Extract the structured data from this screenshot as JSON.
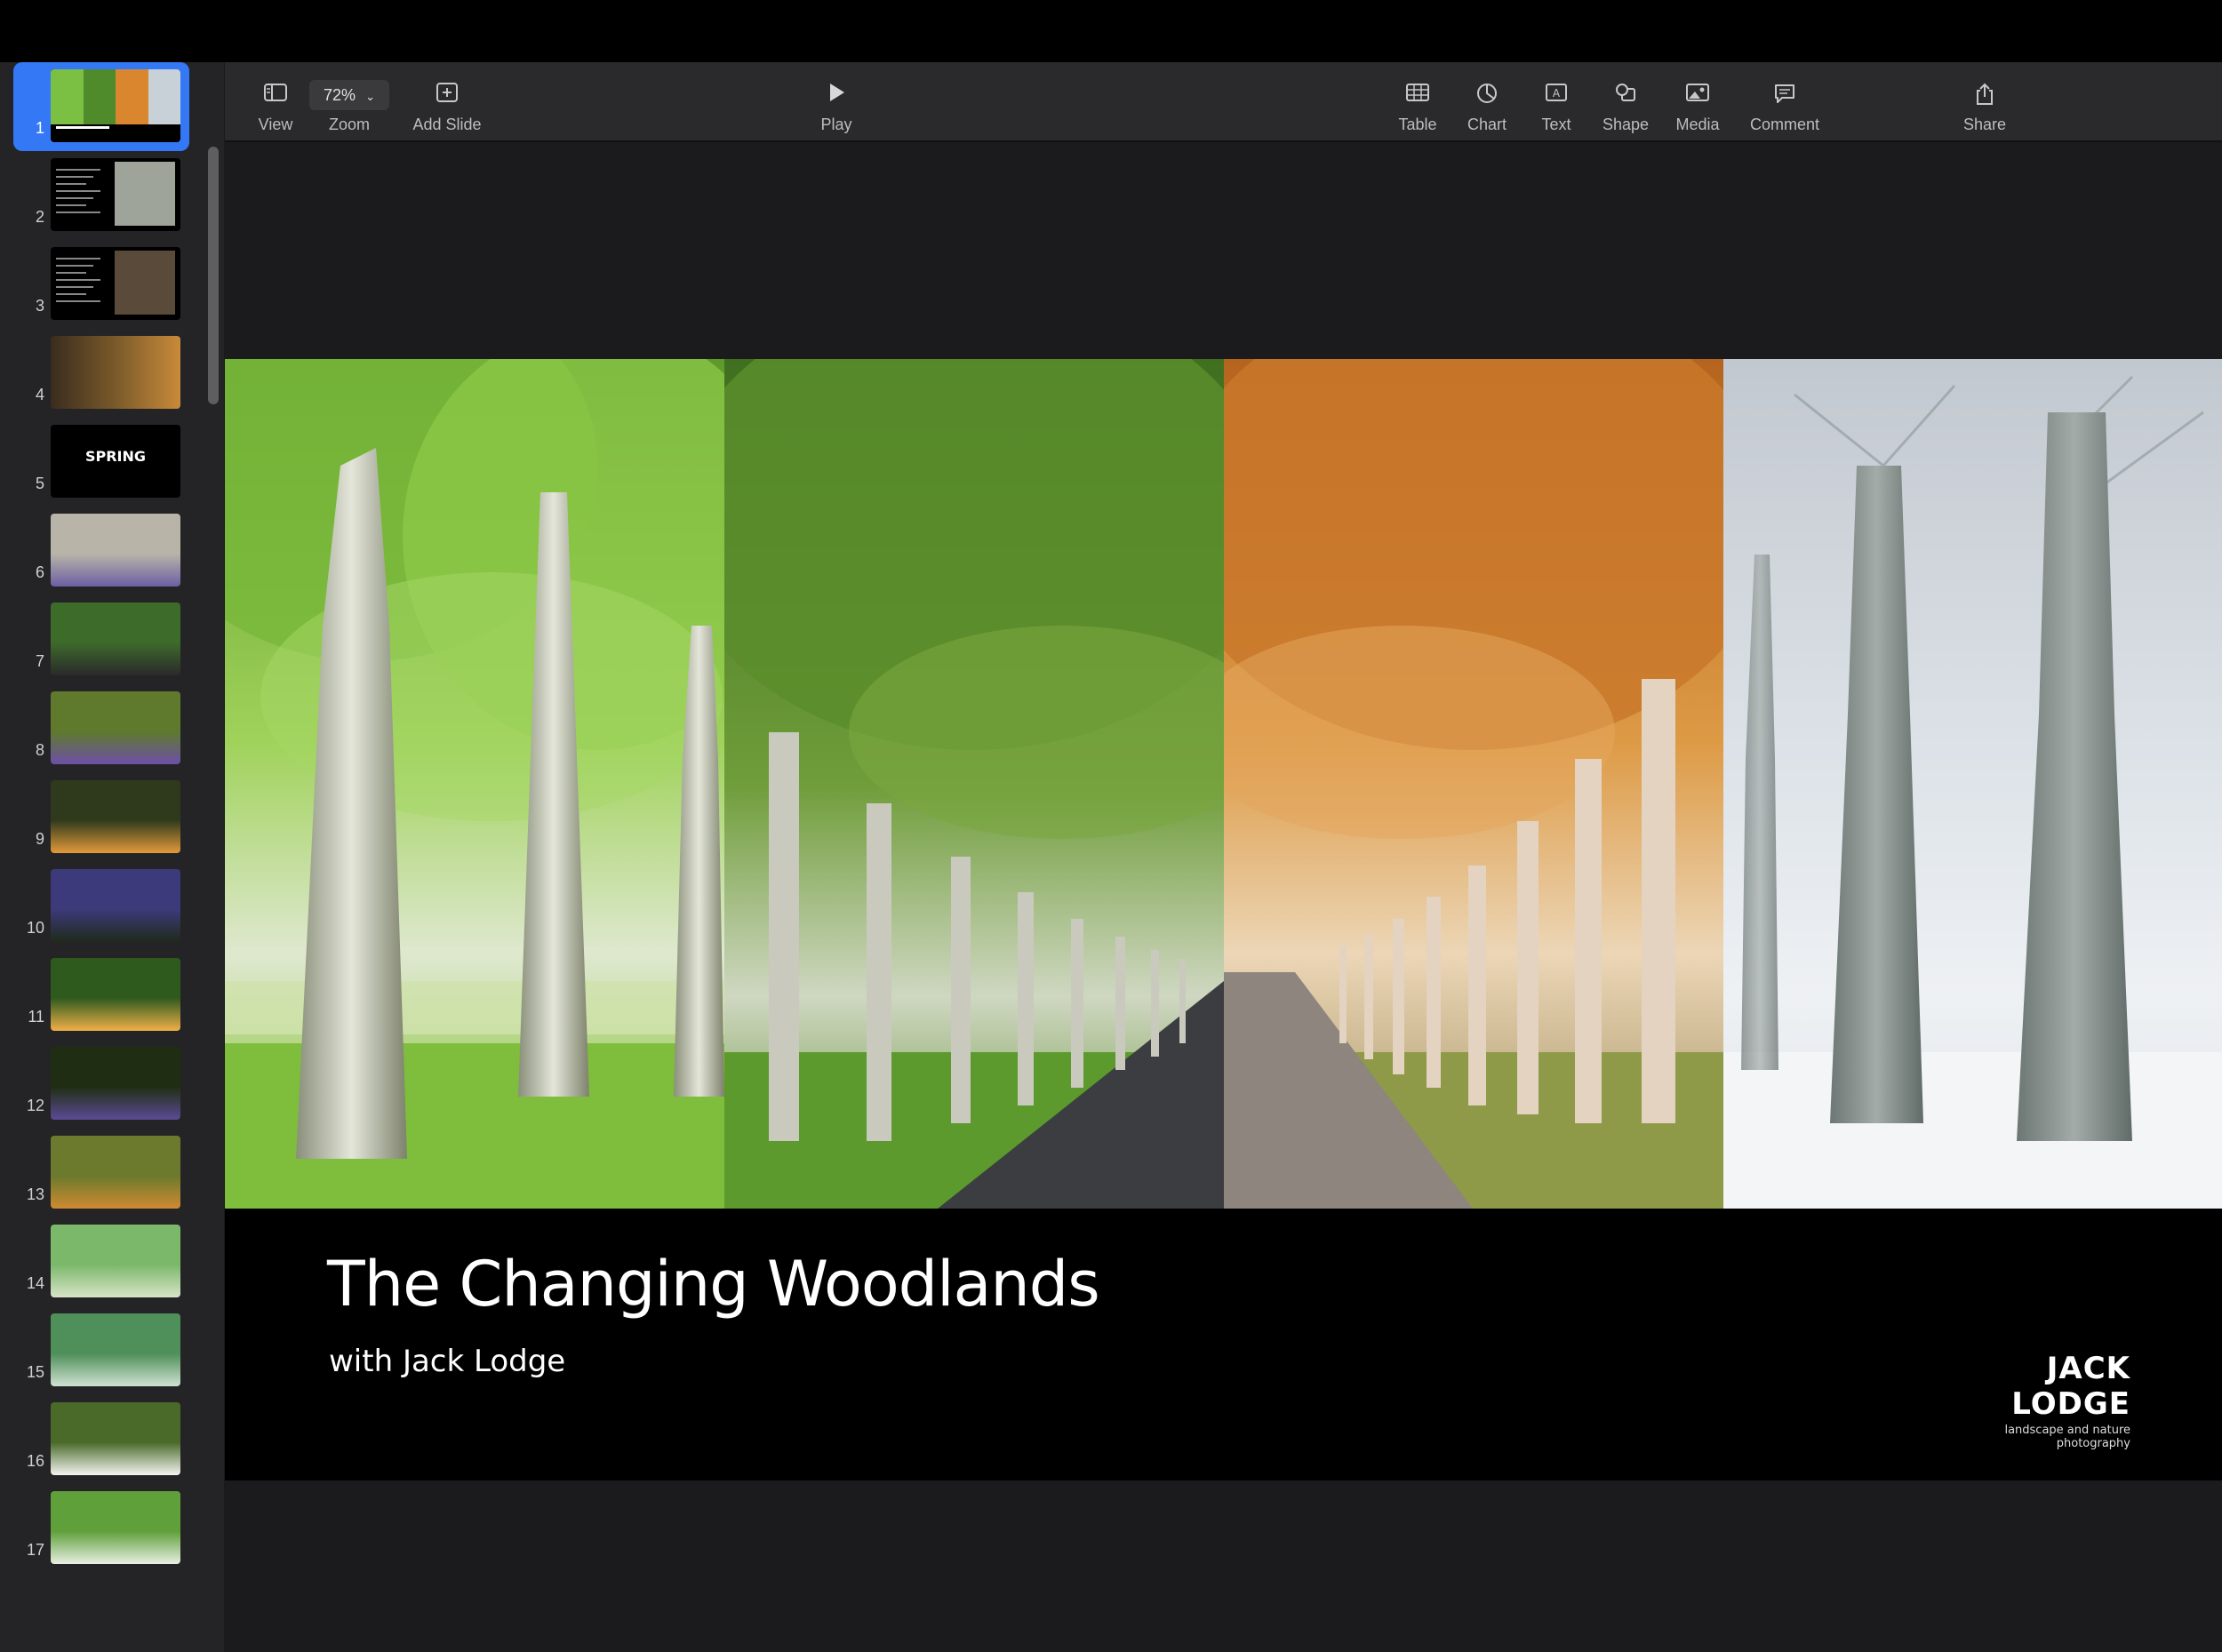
{
  "toolbar": {
    "view_label": "View",
    "zoom_value": "72%",
    "zoom_label": "Zoom",
    "add_slide_label": "Add Slide",
    "play_label": "Play",
    "table_label": "Table",
    "chart_label": "Chart",
    "text_label": "Text",
    "shape_label": "Shape",
    "media_label": "Media",
    "comment_label": "Comment",
    "share_label": "Share"
  },
  "navigator": {
    "selected": "1",
    "slides": [
      {
        "num": "1",
        "kind": "title"
      },
      {
        "num": "2",
        "kind": "text-photo"
      },
      {
        "num": "3",
        "kind": "text-grid"
      },
      {
        "num": "4",
        "kind": "collage"
      },
      {
        "num": "5",
        "kind": "section",
        "label": "SPRING"
      },
      {
        "num": "6",
        "kind": "photo"
      },
      {
        "num": "7",
        "kind": "photo"
      },
      {
        "num": "8",
        "kind": "photo"
      },
      {
        "num": "9",
        "kind": "photo"
      },
      {
        "num": "10",
        "kind": "photo"
      },
      {
        "num": "11",
        "kind": "photo"
      },
      {
        "num": "12",
        "kind": "photo"
      },
      {
        "num": "13",
        "kind": "photo"
      },
      {
        "num": "14",
        "kind": "photo"
      },
      {
        "num": "15",
        "kind": "photo"
      },
      {
        "num": "16",
        "kind": "photo"
      },
      {
        "num": "17",
        "kind": "photo"
      }
    ]
  },
  "slide": {
    "title": "The Changing Woodlands",
    "subtitle": "with Jack Lodge",
    "brand_name": "JACK LODGE",
    "brand_tagline": "landscape and nature photography",
    "panels": [
      "spring",
      "summer",
      "autumn",
      "winter"
    ]
  },
  "colors": {
    "accent": "#3478f6",
    "brand_accent": "#d6231e",
    "spring": "#7cc043",
    "summer": "#4f8a2b",
    "autumn": "#d9862e",
    "winter": "#c9d1d8"
  }
}
